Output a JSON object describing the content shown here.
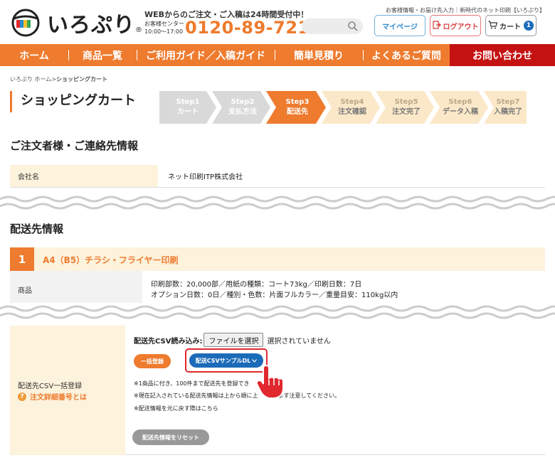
{
  "header": {
    "logo_text": "いろぷり",
    "logo_reg": "®",
    "tagline": "WEBからのご注文・ご入稿は24時間受付中！",
    "center_label": "お客様センター",
    "center_hours": "10:00〜17:00",
    "phone": "0120-89-7216",
    "top_links": "お客様情報・お届け先入力｜新時代のネット印刷【いろぷり】",
    "mypage_label": "マイページ",
    "logout_label": "ログアウト",
    "cart_label": "カート",
    "cart_count": "1"
  },
  "nav": {
    "items": [
      "ホーム",
      "商品一覧",
      "ご利用ガイド／入稿ガイド",
      "簡単見積り",
      "よくあるご質問",
      "お問い合わせ"
    ]
  },
  "breadcrumb": {
    "home": "いろぷり ホーム",
    "sep": ">",
    "current": "ショッピングカート"
  },
  "page_title": "ショッピングカート",
  "steps": [
    {
      "num": "Step1",
      "label": "カート",
      "state": "done"
    },
    {
      "num": "Step2",
      "label": "支払方法",
      "state": "done"
    },
    {
      "num": "Step3",
      "label": "配送先",
      "state": "current"
    },
    {
      "num": "Step4",
      "label": "注文確認",
      "state": "todo"
    },
    {
      "num": "Step5",
      "label": "注文完了",
      "state": "todo"
    },
    {
      "num": "Step6",
      "label": "データ入稿",
      "state": "todo"
    },
    {
      "num": "Step7",
      "label": "入稿完了",
      "state": "todo"
    }
  ],
  "orderer": {
    "title": "ご注文者様・ご連絡先情報",
    "company_label": "会社名",
    "company_value": "ネット印刷ITP株式会社"
  },
  "delivery": {
    "title": "配送先情報",
    "product_num": "1",
    "product_name": "A4（B5）チラシ・フライヤー印刷",
    "item_label": "商品",
    "item_line1": "印刷部数：20,000部／用紙の種類：コート73kg／印刷日数：7日",
    "item_line2": "オプション日数：0日／種別・色数：片面フルカラー／重量目安：110kg以内"
  },
  "csv": {
    "label": "配送先CSV一括登録",
    "help_icon": "?",
    "help_text": "注文詳細番号とは",
    "read_label": "配送先CSV読み込み:",
    "file_button": "ファイルを選択",
    "file_status": "選択されていません",
    "bulk_button": "一括登録",
    "sample_button": "配送CSVサンプルDL",
    "note1": "※1商品に付き、100件まで配送先を登録でき",
    "note2": "※現在記入されている配送先情報は上から順に上",
    "note2b": "されます注意してください。",
    "note3": "※配送情報を元に戻す際はこちら",
    "reset_button": "配送先情報をリセット"
  },
  "colors": {
    "brand_orange": "#ee7b2e",
    "contact_red": "#c41212",
    "label_bg": "#fdf2dc",
    "blue": "#1c6bb8"
  }
}
